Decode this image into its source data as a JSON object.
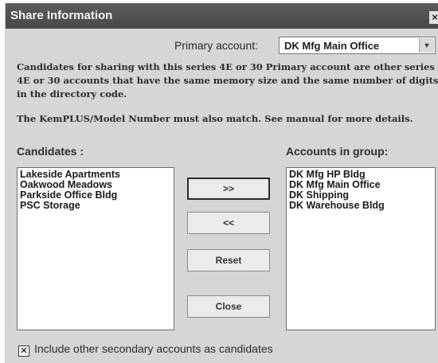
{
  "window": {
    "title": "Share Information",
    "close_glyph": "×"
  },
  "primary": {
    "label": "Primary account:",
    "value": "DK Mfg Main Office",
    "arrow_glyph": "▼"
  },
  "description": {
    "para1": "Candidates for sharing with this series 4E or 30 Primary account are other series 4E or 30 accounts that have the same memory size and the same number of digits in the directory code.",
    "para2": "The KemPLUS/Model Number must also match. See manual for more details."
  },
  "candidates": {
    "label": "Candidates :",
    "items": [
      "Lakeside Apartments",
      "Oakwood Meadows",
      "Parkside Office Bldg",
      "PSC Storage"
    ]
  },
  "accounts_in_group": {
    "label": "Accounts in group:",
    "items": [
      "DK Mfg HP Bldg",
      "DK Mfg Main Office",
      "DK Shipping",
      "DK Warehouse Bldg"
    ]
  },
  "buttons": {
    "add": ">>",
    "remove": "<<",
    "reset": "Reset",
    "close": "Close"
  },
  "include_secondary": {
    "checked": true,
    "check_glyph": "✕",
    "label": "Include other secondary accounts as candidates"
  }
}
